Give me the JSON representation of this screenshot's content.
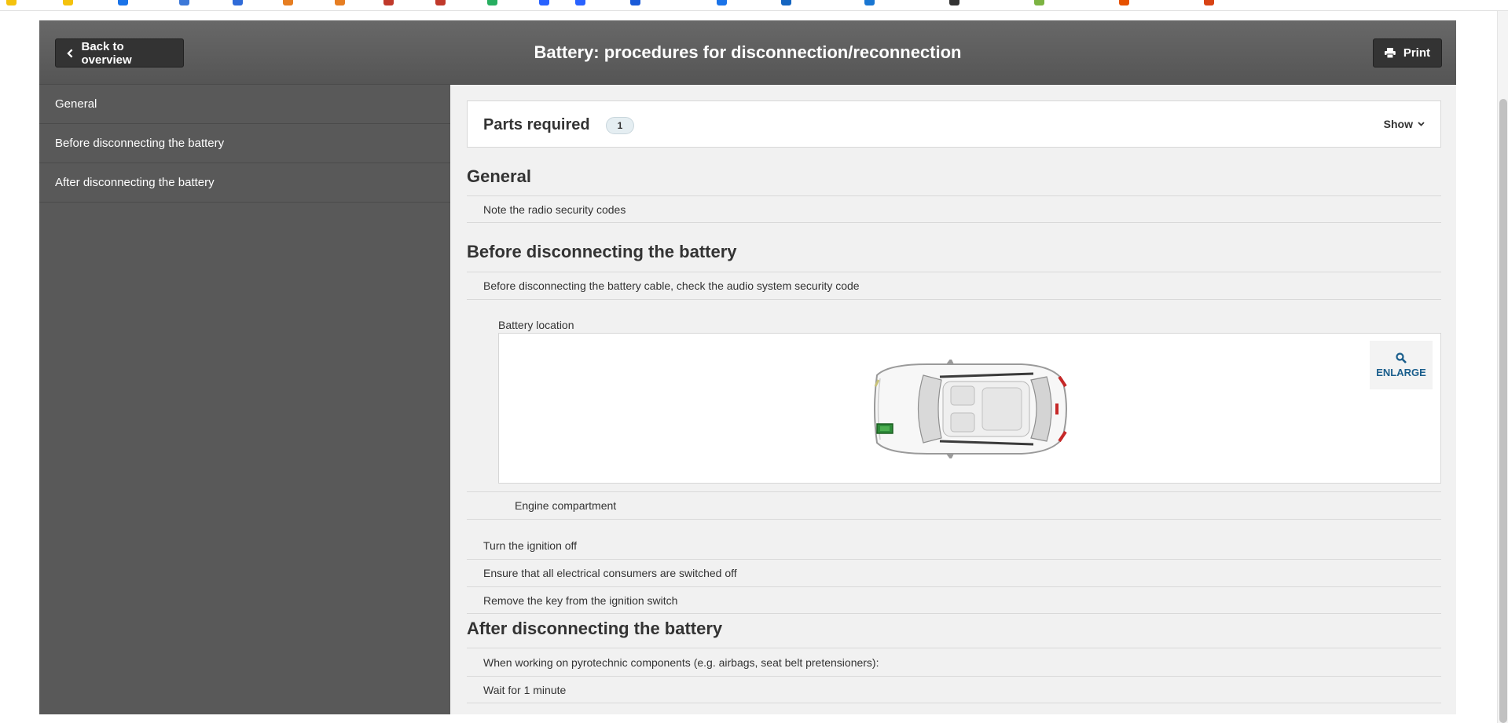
{
  "page": {
    "title": "Battery: procedures for disconnection/reconnection",
    "back_label": "Back to overview",
    "print_label": "Print"
  },
  "sidebar": {
    "items": [
      {
        "label": "General"
      },
      {
        "label": "Before disconnecting the battery"
      },
      {
        "label": "After disconnecting the battery"
      }
    ]
  },
  "parts": {
    "title": "Parts required",
    "count": "1",
    "toggle_label": "Show"
  },
  "sections": {
    "general": {
      "heading": "General",
      "rows": [
        "Note the radio security codes"
      ]
    },
    "before": {
      "heading": "Before disconnecting the battery",
      "intro": "Before disconnecting the battery cable, check the audio system security code",
      "figure_label": "Battery location",
      "enlarge_label": "ENLARGE",
      "figure_caption": "Engine compartment",
      "steps": [
        "Turn the ignition off",
        "Ensure that all electrical consumers are switched off",
        "Remove the key from the ignition switch"
      ]
    },
    "after": {
      "heading": "After disconnecting the battery",
      "rows": [
        "When working on pyrotechnic components (e.g. airbags, seat belt pretensioners):",
        "Wait for 1 minute"
      ]
    }
  },
  "colors": {
    "header_bg": "#5f5f5f",
    "sidebar_bg": "#595959",
    "content_bg": "#f1f1f1",
    "accent": "#1a5e8c",
    "battery": "#2e8b3a"
  },
  "icons": {
    "back": "chevron-left-icon",
    "print": "printer-icon",
    "toggle": "chevron-down-icon",
    "enlarge": "magnifier-icon"
  }
}
